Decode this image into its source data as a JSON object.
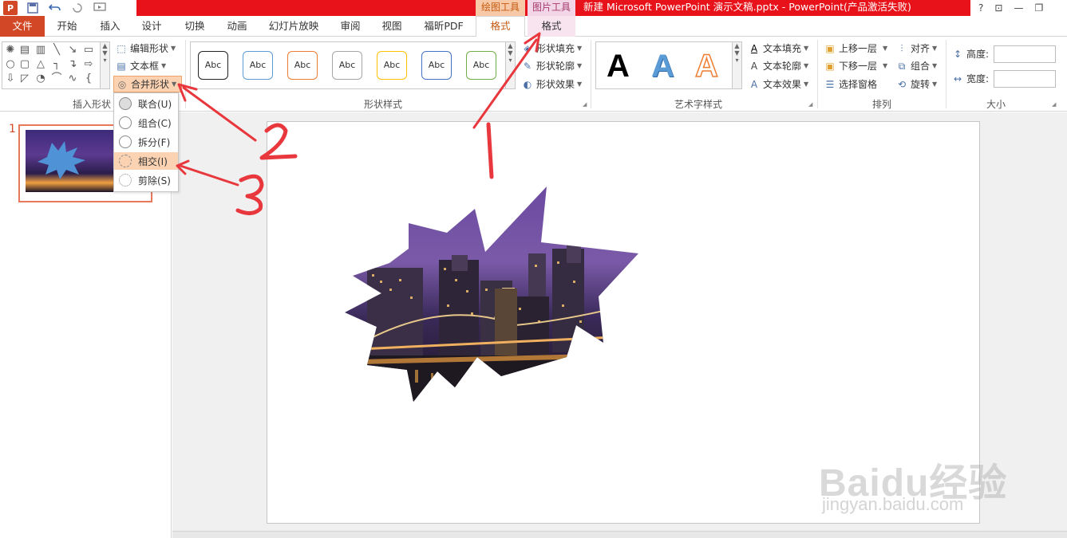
{
  "qat": {
    "app_logo": "P",
    "save_icon": "save-icon",
    "undo_icon": "undo-icon",
    "redo_icon": "redo-icon",
    "present_icon": "present-icon"
  },
  "titlebar": {
    "context_draw": "绘图工具",
    "context_picture": "图片工具",
    "doc_title": "新建 Microsoft PowerPoint 演示文稿.pptx -  PowerPoint(产品激活失败)",
    "help": "?",
    "restore_ribbon": "⊡",
    "minimize": "—",
    "maximize": "❐"
  },
  "tabs": {
    "file": "文件",
    "items": [
      "开始",
      "插入",
      "设计",
      "切换",
      "动画",
      "幻灯片放映",
      "审阅",
      "视图",
      "福昕PDF"
    ],
    "format_draw": "格式",
    "format_picture": "格式"
  },
  "ribbon": {
    "insert_shapes": {
      "label": "插入形状",
      "edit_shape": "编辑形状",
      "text_box": "文本框",
      "merge_shapes": "合并形状"
    },
    "shape_styles": {
      "label": "形状样式",
      "swatch_text": "Abc",
      "swatch_colors": [
        "#222222",
        "#5b9bd5",
        "#ed7d31",
        "#a5a5a5",
        "#ffc000",
        "#4472c4",
        "#70ad47"
      ],
      "fill": "形状填充",
      "outline": "形状轮廓",
      "effects": "形状效果"
    },
    "wordart": {
      "label": "艺术字样式",
      "letter": "A",
      "text_fill": "文本填充",
      "text_outline": "文本轮廓",
      "text_effects": "文本效果"
    },
    "arrange": {
      "label": "排列",
      "bring_forward": "上移一层",
      "send_backward": "下移一层",
      "selection_pane": "选择窗格",
      "align": "对齐",
      "group": "组合",
      "rotate": "旋转"
    },
    "size": {
      "label": "大小",
      "height_label": "高度:",
      "width_label": "宽度:",
      "height_value": "",
      "width_value": ""
    }
  },
  "merge_menu": {
    "union": "联合(U)",
    "combine": "组合(C)",
    "fragment": "拆分(F)",
    "intersect": "相交(I)",
    "subtract": "剪除(S)"
  },
  "slides": {
    "thumb_number": "1"
  },
  "watermark": {
    "logo": "Baidu经验",
    "url": "jingyan.baidu.com"
  },
  "colors": {
    "accent": "#d24726",
    "title_red": "#e8131a",
    "annotation": "#e8383d",
    "highlight": "#fbd3b3"
  }
}
